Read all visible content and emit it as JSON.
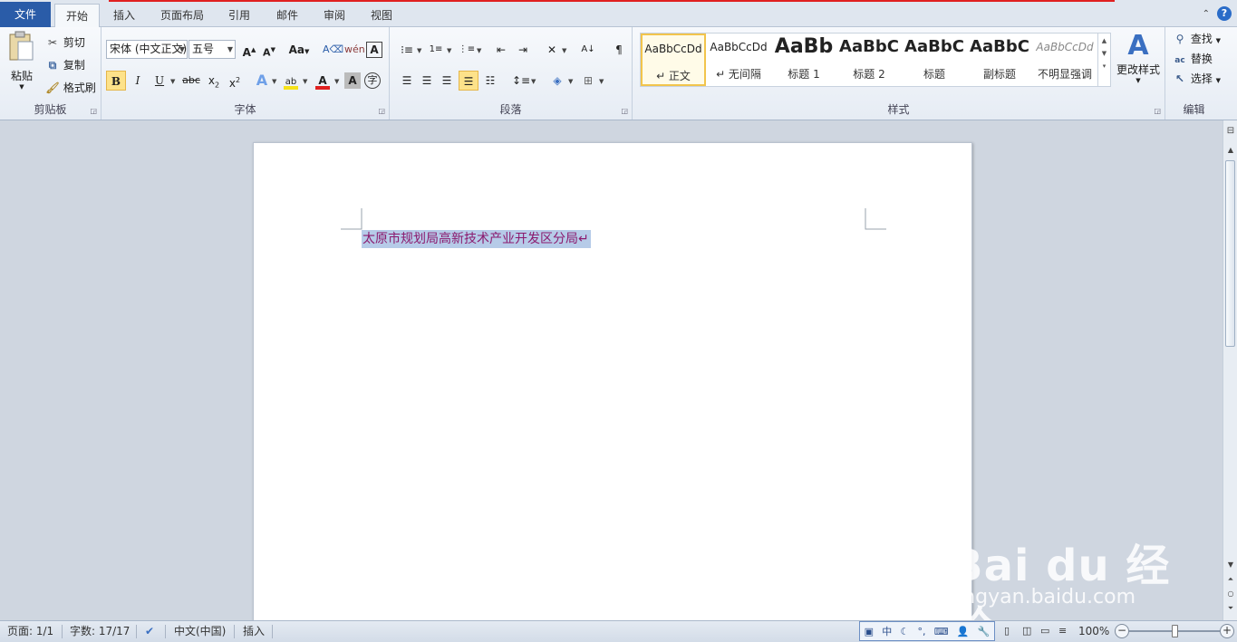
{
  "tabs": [
    {
      "label": "文件"
    },
    {
      "label": "开始"
    },
    {
      "label": "插入"
    },
    {
      "label": "页面布局"
    },
    {
      "label": "引用"
    },
    {
      "label": "邮件"
    },
    {
      "label": "审阅"
    },
    {
      "label": "视图"
    }
  ],
  "active_tab": "开始",
  "clipboard": {
    "paste": "粘贴",
    "cut": "剪切",
    "copy": "复制",
    "format_painter": "格式刷",
    "group_label": "剪贴板"
  },
  "font": {
    "font_name": "宋体 (中文正文)",
    "font_size": "五号",
    "change_case": "Aa",
    "group_label": "字体"
  },
  "paragraph": {
    "group_label": "段落"
  },
  "styles": {
    "items": [
      {
        "preview": "AaBbCcDd",
        "label": "↵ 正文",
        "selected": true
      },
      {
        "preview": "AaBbCcDd",
        "label": "↵ 无间隔"
      },
      {
        "preview": "AaBb",
        "label": "标题 1"
      },
      {
        "preview": "AaBbC",
        "label": "标题 2"
      },
      {
        "preview": "AaBbC",
        "label": "标题"
      },
      {
        "preview": "AaBbC",
        "label": "副标题"
      },
      {
        "preview": "AaBbCcDd",
        "label": "不明显强调"
      }
    ],
    "change_styles": "更改样式",
    "group_label": "样式"
  },
  "editing": {
    "find": "查找",
    "replace": "替换",
    "select": "选择",
    "group_label": "编辑"
  },
  "document": {
    "text": "太原市规划局高新技术产业开发区分局↵",
    "text_color": "#8b1a6e",
    "highlight_color": "#b6cbe8"
  },
  "status": {
    "page": "页面: 1/1",
    "words": "字数: 17/17",
    "language": "中文(中国)",
    "mode": "插入",
    "zoom": "100%",
    "zoom_level_percent": 100
  },
  "ime": {
    "mode": "中"
  },
  "watermark": {
    "brand": "Bai du 经验",
    "url": "jingyan.baidu.com"
  },
  "colors": {
    "file_tab": "#2a5ca8",
    "font_color_bar": "#e02020",
    "highlight_bar": "#f6e21a"
  }
}
